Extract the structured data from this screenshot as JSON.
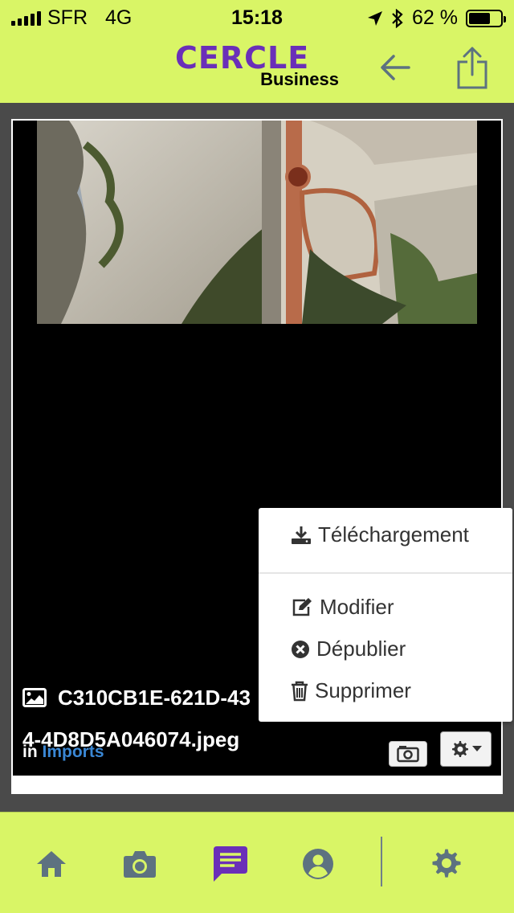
{
  "status_bar": {
    "carrier": "SFR",
    "network": "4G",
    "time": "15:18",
    "battery_percent": "62 %",
    "battery_level": 0.62
  },
  "header": {
    "logo_main": "CERCLE",
    "logo_sub": "Business",
    "back_icon": "arrow-left-icon",
    "share_icon": "share-icon"
  },
  "media": {
    "filename_line1": "C310CB1E-621D-43",
    "filename_line2": "4-4D8D5A046074.jpeg",
    "in_label": "in",
    "album": "Imports"
  },
  "menu": {
    "download": "Téléchargement",
    "edit": "Modifier",
    "unpublish": "Dépublier",
    "delete": "Supprimer"
  },
  "bottom_nav": [
    "home-icon",
    "camera-icon",
    "messages-icon",
    "profile-icon",
    "settings-icon"
  ],
  "colors": {
    "accent": "#d9f566",
    "brand": "#6a2fb8",
    "link": "#3a87d4",
    "nav_icon": "#5d7280",
    "nav_active": "#6a2fb8"
  }
}
